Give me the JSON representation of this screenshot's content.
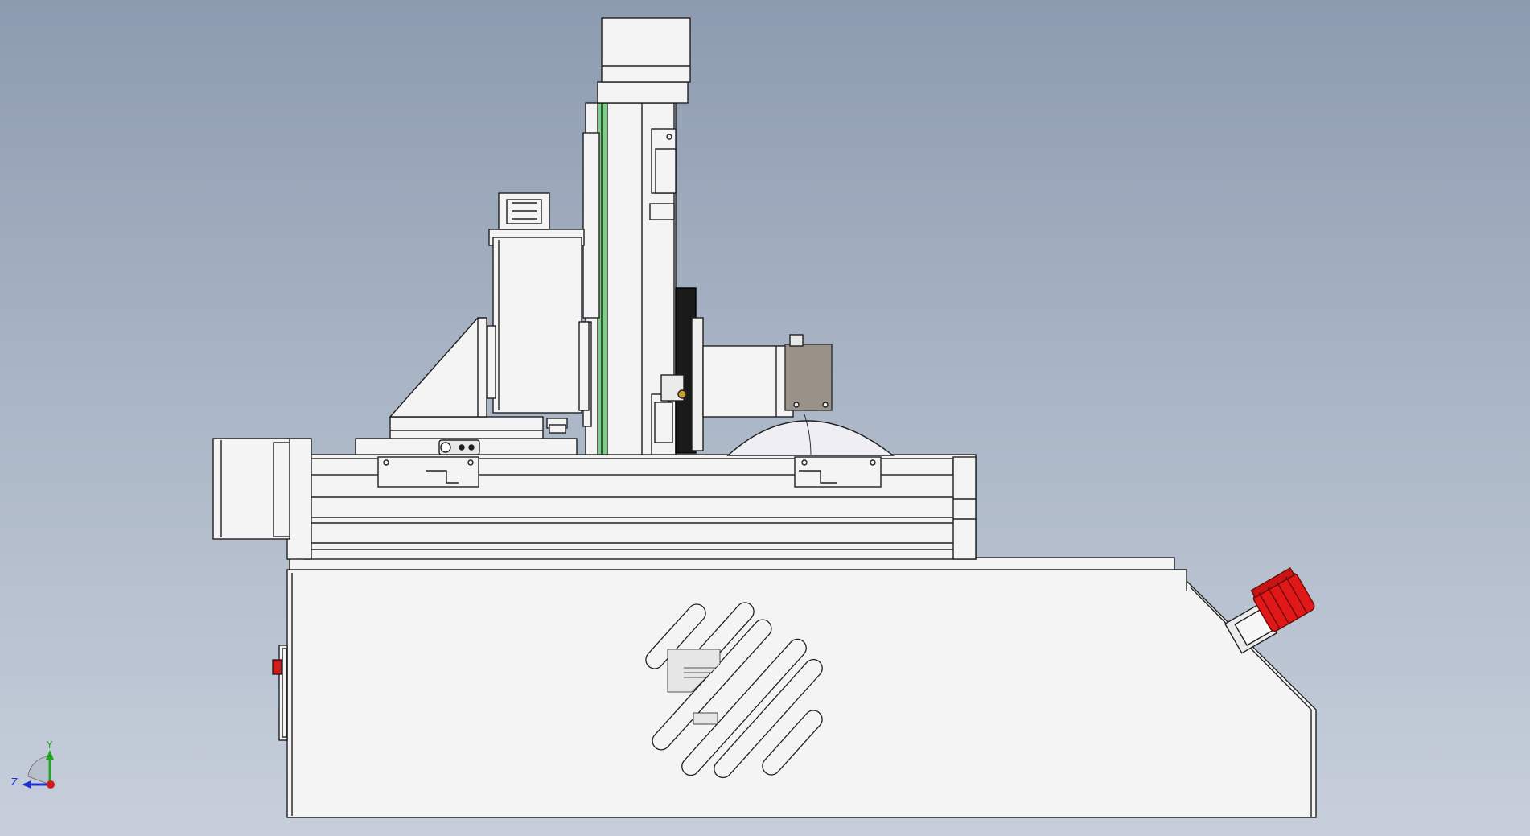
{
  "viewport": {
    "background_top": "#8d9bb0",
    "background_bottom": "#c7cfdb"
  },
  "model": {
    "outline_color": "#202020",
    "body_fill": "#f4f4f4",
    "rail_accent_color": "#7ccf86",
    "estop_color": "#e01818",
    "sensor_block_color": "#9a9288",
    "indicator_color": "#d01c1c"
  },
  "triad": {
    "x_label": "",
    "y_label": "Y",
    "z_label": "Z",
    "y_color": "#1fa81f",
    "z_color": "#2030d0",
    "x_color": "#d01c1c"
  }
}
